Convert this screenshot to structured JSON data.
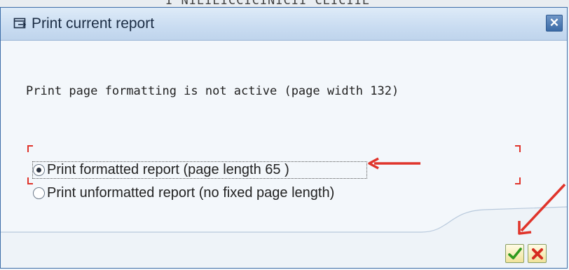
{
  "window": {
    "title": "Print current report"
  },
  "background": {
    "fragment_text": "I NIEIEICCICINICII    CEICIIE"
  },
  "message": {
    "text": "Print page formatting is not active (page width 132)"
  },
  "options": [
    {
      "label": "Print formatted report (page length 65 )",
      "selected": true
    },
    {
      "label": "Print unformatted report (no fixed page length)",
      "selected": false
    }
  ],
  "icons": {
    "title": "popup-window-icon",
    "close": "close-icon",
    "confirm": "green-checkmark-icon",
    "cancel": "red-x-icon"
  },
  "colors": {
    "annotation": "#e0342b",
    "titlebar": "#c9dcf1",
    "confirm": "#2f9a1e",
    "cancel": "#d62b1f"
  }
}
